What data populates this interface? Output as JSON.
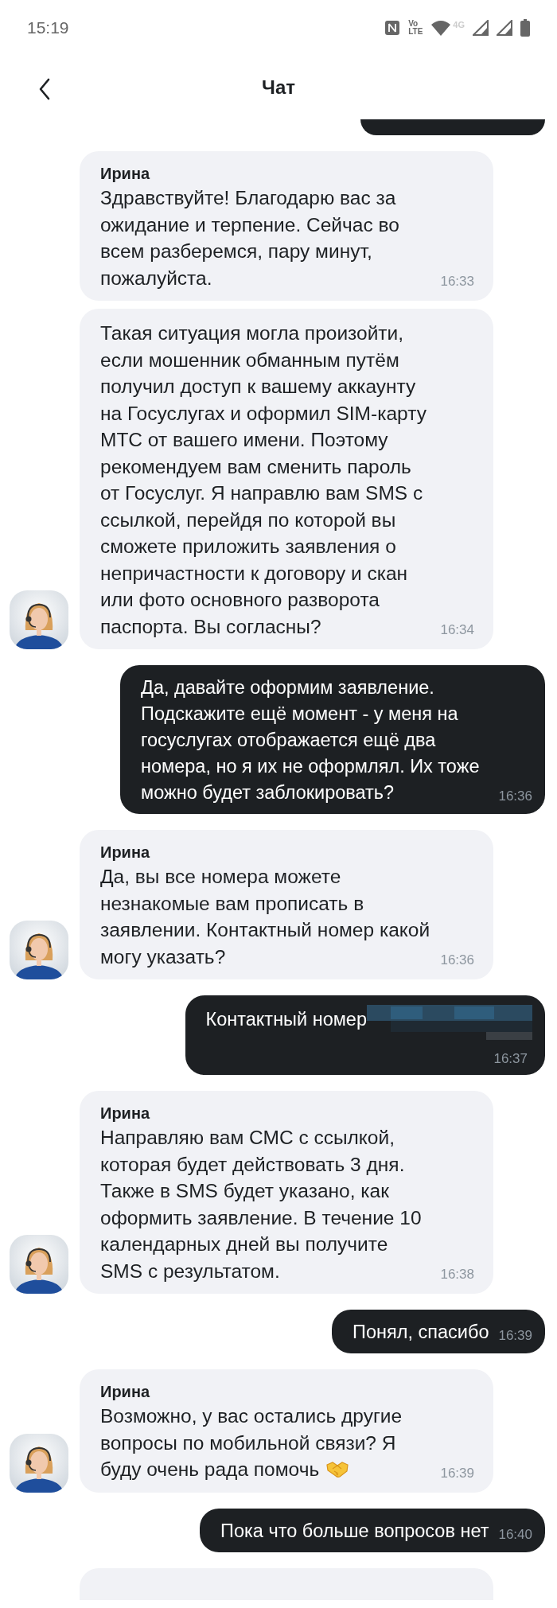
{
  "status_bar": {
    "time": "15:19",
    "volte_top": "Vo",
    "volte_bottom": "LTE",
    "network": "4G"
  },
  "header": {
    "title": "Чат"
  },
  "messages": [
    {
      "kind": "cut_outgoing"
    },
    {
      "kind": "incoming",
      "sender": "Ирина",
      "text": "Здравствуйте! Благодарю вас за ожидание и терпение. Сейчас во всем разберемся, пару минут, пожалуйста.",
      "time": "16:33",
      "avatar": false
    },
    {
      "kind": "incoming",
      "text": "Такая ситуация могла произойти, если мошенник обманным путём получил доступ к вашему аккаунту на Госуслугах и оформил SIM-карту МТС от вашего имени. Поэтому рекомендуем вам сменить пароль от Госуслуг. Я направлю вам SMS с ссылкой, перейдя по которой вы сможете приложить заявления о непричастности к договору и скан или фото основного разворота паспорта. Вы согласны?",
      "time": "16:34",
      "avatar": true
    },
    {
      "kind": "outgoing",
      "text": "Да, давайте оформим заявление. Подскажите ещё момент - у меня на госуслугах отображается ещё два номера, но я их не оформлял. Их тоже можно будет заблокировать?",
      "time": "16:36"
    },
    {
      "kind": "incoming",
      "sender": "Ирина",
      "text": "Да, вы все номера можете незнакомые вам прописать в заявлении. Контактный номер какой могу указать?",
      "time": "16:36",
      "avatar": true
    },
    {
      "kind": "outgoing",
      "text": "Контактный номер",
      "time": "16:37",
      "redacted": true
    },
    {
      "kind": "incoming",
      "sender": "Ирина",
      "text": "Направляю вам СМС с ссылкой, которая будет действовать 3 дня. Также в SMS будет указано, как оформить заявление. В течение 10 календарных дней вы получите SMS с результатом.",
      "time": "16:38",
      "avatar": true
    },
    {
      "kind": "outgoing",
      "text": "Понял, спасибо",
      "time": "16:39"
    },
    {
      "kind": "incoming",
      "sender": "Ирина",
      "text": "Возможно, у вас остались другие вопросы по мобильной связи? Я буду очень рада помочь",
      "emoji_icon": true,
      "time": "16:39",
      "avatar": true
    },
    {
      "kind": "outgoing",
      "text": "Пока что больше вопросов нет",
      "time": "16:40"
    },
    {
      "kind": "cut_incoming"
    }
  ]
}
